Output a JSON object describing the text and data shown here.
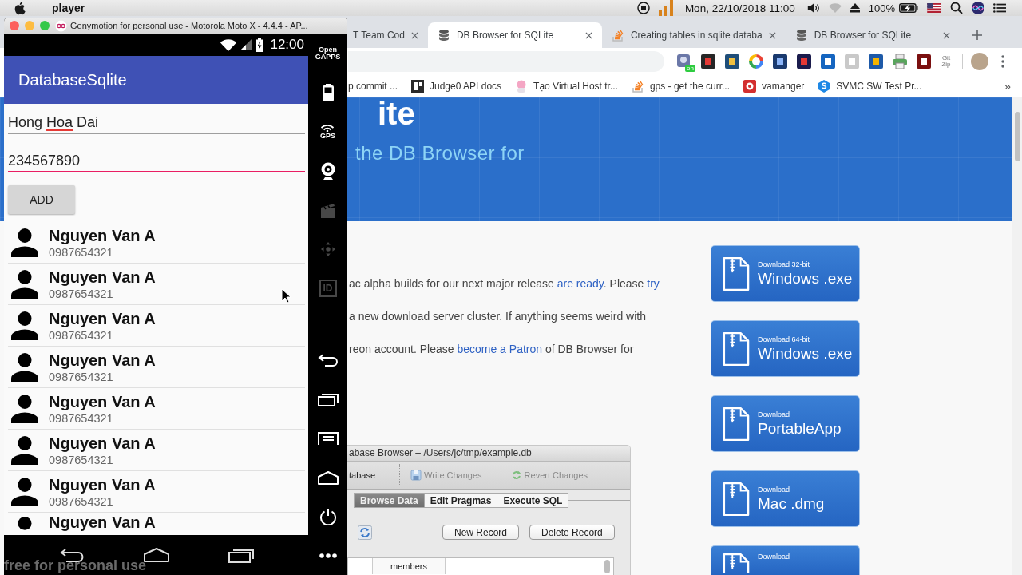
{
  "menu_bar": {
    "app_name": "player",
    "clock": "Mon, 22/10/2018 11:00",
    "battery_percent": "100%"
  },
  "genymotion": {
    "title": "Genymotion for personal use - Motorola Moto X - 4.4.4 - AP...",
    "status_bar": {
      "time": "12:00"
    },
    "app_bar": {
      "title": "DatabaseSqlite"
    },
    "fields": [
      {
        "value_parts": [
          {
            "text": "Hong ",
            "misspelled": false
          },
          {
            "text": "Hoa",
            "misspelled": true
          },
          {
            "text": " Dai",
            "misspelled": false
          }
        ],
        "focused": false
      },
      {
        "value_parts": [
          {
            "text": "234567890",
            "misspelled": false
          }
        ],
        "focused": true
      }
    ],
    "add_button": "ADD",
    "contacts": [
      {
        "name": "Nguyen Van A",
        "phone": "0987654321"
      },
      {
        "name": "Nguyen Van A",
        "phone": "0987654321"
      },
      {
        "name": "Nguyen Van A",
        "phone": "0987654321"
      },
      {
        "name": "Nguyen Van A",
        "phone": "0987654321"
      },
      {
        "name": "Nguyen Van A",
        "phone": "0987654321"
      },
      {
        "name": "Nguyen Van A",
        "phone": "0987654321"
      },
      {
        "name": "Nguyen Van A",
        "phone": "0987654321"
      },
      {
        "name": "Nguyen Van A"
      }
    ],
    "overlay_note": "free for personal use",
    "sidebar": {
      "tools": [
        {
          "kind": "gapps",
          "label": "Open GAPPS",
          "disabled": false
        },
        {
          "kind": "battery",
          "disabled": false
        },
        {
          "kind": "gps",
          "label": "GPS",
          "disabled": false
        },
        {
          "kind": "webcam",
          "disabled": false
        },
        {
          "kind": "capture",
          "disabled": true
        },
        {
          "kind": "dpad",
          "disabled": true
        },
        {
          "kind": "id",
          "label": "ID",
          "disabled": true
        }
      ],
      "controls": [
        {
          "kind": "back"
        },
        {
          "kind": "recents"
        },
        {
          "kind": "menu"
        },
        {
          "kind": "home"
        },
        {
          "kind": "power"
        },
        {
          "kind": "more"
        }
      ]
    }
  },
  "browser": {
    "tabs": [
      {
        "title": "T Team Cod",
        "selected": false,
        "kind": "plain"
      },
      {
        "title": "DB Browser for SQLite",
        "selected": true,
        "kind": "database"
      },
      {
        "title": "Creating tables in sqlite databa",
        "selected": false,
        "kind": "stack"
      },
      {
        "title": "DB Browser for SQLite",
        "selected": false,
        "kind": "database"
      }
    ],
    "toolbar": {
      "extension_badge": "on",
      "extension_label": "Git Zip"
    },
    "bookmarks": [
      {
        "label": "p commit ...",
        "kind": "plain"
      },
      {
        "label": "Judge0 API docs",
        "kind": "doc"
      },
      {
        "label": "Tạo Virtual Host tr...",
        "kind": "avatar"
      },
      {
        "label": "gps - get the curr...",
        "kind": "stack"
      },
      {
        "label": "vamanger",
        "kind": "target"
      },
      {
        "label": "SVMC SW Test Pr...",
        "kind": "hexagon"
      }
    ],
    "bookmarks_overflow": "»",
    "page": {
      "banner": {
        "heading": "ite",
        "subtitle": "the DB Browser for"
      },
      "paragraphs": [
        [
          {
            "text": "ac alpha builds for our next major release ",
            "link": false
          },
          {
            "text": "are ready",
            "link": true
          },
          {
            "text": ". Please ",
            "link": false
          },
          {
            "text": "try",
            "link": true
          }
        ],
        [
          {
            "text": "a new download server cluster. If anything seems weird with",
            "link": false
          }
        ],
        [
          {
            "text": "reon account. Please ",
            "link": false
          },
          {
            "text": "become a Patron",
            "link": true
          },
          {
            "text": " of DB Browser for",
            "link": false
          }
        ]
      ],
      "app_screenshot": {
        "title": "abase Browser – /Users/jc/tmp/example.db",
        "toolbar": [
          {
            "label": "tabase",
            "kind": "plain",
            "disabled": false
          },
          {
            "label": "Write Changes",
            "kind": "save",
            "disabled": true
          },
          {
            "label": "Revert Changes",
            "kind": "revert",
            "disabled": true
          }
        ],
        "tabs": [
          {
            "label": "Browse Data",
            "selected": true
          },
          {
            "label": "Edit Pragmas",
            "selected": false
          },
          {
            "label": "Execute SQL",
            "selected": false
          }
        ],
        "buttons": [
          "New Record",
          "Delete Record"
        ],
        "columns": [
          "members"
        ]
      },
      "downloads": [
        {
          "caption": "Download 32-bit",
          "target": "Windows .exe"
        },
        {
          "caption": "Download 64-bit",
          "target": "Windows .exe"
        },
        {
          "caption": "Download",
          "target": "PortableApp"
        },
        {
          "caption": "Download",
          "target": "Mac .dmg"
        },
        {
          "caption": "Download"
        }
      ]
    }
  }
}
